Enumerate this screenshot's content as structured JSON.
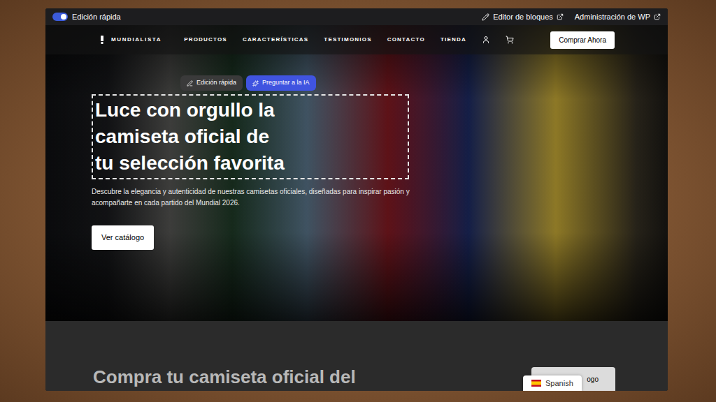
{
  "toolbar": {
    "quick_edit": {
      "label": "Edición rápida",
      "on": true
    },
    "links": [
      "Editor de bloques",
      "Administración de WP"
    ]
  },
  "nav": {
    "logo": "MUNDIALISTA",
    "items": [
      "PRODUCTOS",
      "CARACTERÍSTICAS",
      "TESTIMONIOS",
      "CONTACTO",
      "TIENDA"
    ],
    "cta": "Comprar Ahora"
  },
  "hero": {
    "edit_chips": [
      {
        "label": "Edición rápida",
        "kind": "edit"
      },
      {
        "label": "Preguntar a la IA",
        "kind": "ai"
      }
    ],
    "title_lines": [
      "Luce con orgullo la",
      "camiseta oficial de",
      "tu selección favorita"
    ],
    "description": "Descubre la elegancia y autenticidad de nuestras camisetas oficiales, diseñadas para inspirar pasión y acompañarte en cada partido del Mundial 2026.",
    "button": "Ver catálogo"
  },
  "section": {
    "title": "Compra tu camiseta oficial del"
  },
  "floating_card": {
    "label": "ogo"
  },
  "language": {
    "label": "Spanish"
  }
}
